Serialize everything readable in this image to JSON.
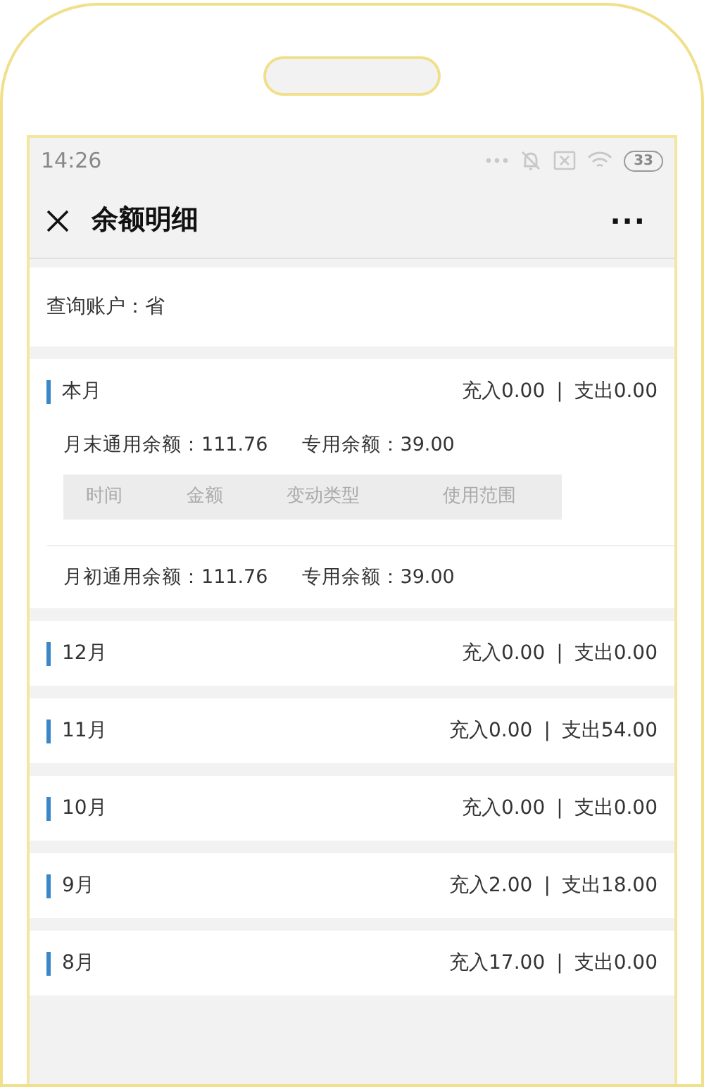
{
  "status_bar": {
    "time": "14:26",
    "battery": "33"
  },
  "nav": {
    "title": "余额明细",
    "menu": "···"
  },
  "account": {
    "label": "查询账户：省"
  },
  "months": [
    {
      "name": "本月",
      "income": "充入0.00",
      "separator": "|",
      "expense": "支出0.00",
      "detail": {
        "end_general": "月末通用余额：111.76",
        "end_special": "专用余额：39.00",
        "columns": [
          "时间",
          "金额",
          "变动类型",
          "使用范围"
        ],
        "start_general": "月初通用余额：111.76",
        "start_special": "专用余额：39.00"
      }
    },
    {
      "name": "12月",
      "income": "充入0.00",
      "separator": "|",
      "expense": "支出0.00"
    },
    {
      "name": "11月",
      "income": "充入0.00",
      "separator": "|",
      "expense": "支出54.00"
    },
    {
      "name": "10月",
      "income": "充入0.00",
      "separator": "|",
      "expense": "支出0.00"
    },
    {
      "name": "9月",
      "income": "充入2.00",
      "separator": "|",
      "expense": "支出18.00"
    },
    {
      "name": "8月",
      "income": "充入17.00",
      "separator": "|",
      "expense": "支出0.00"
    }
  ]
}
